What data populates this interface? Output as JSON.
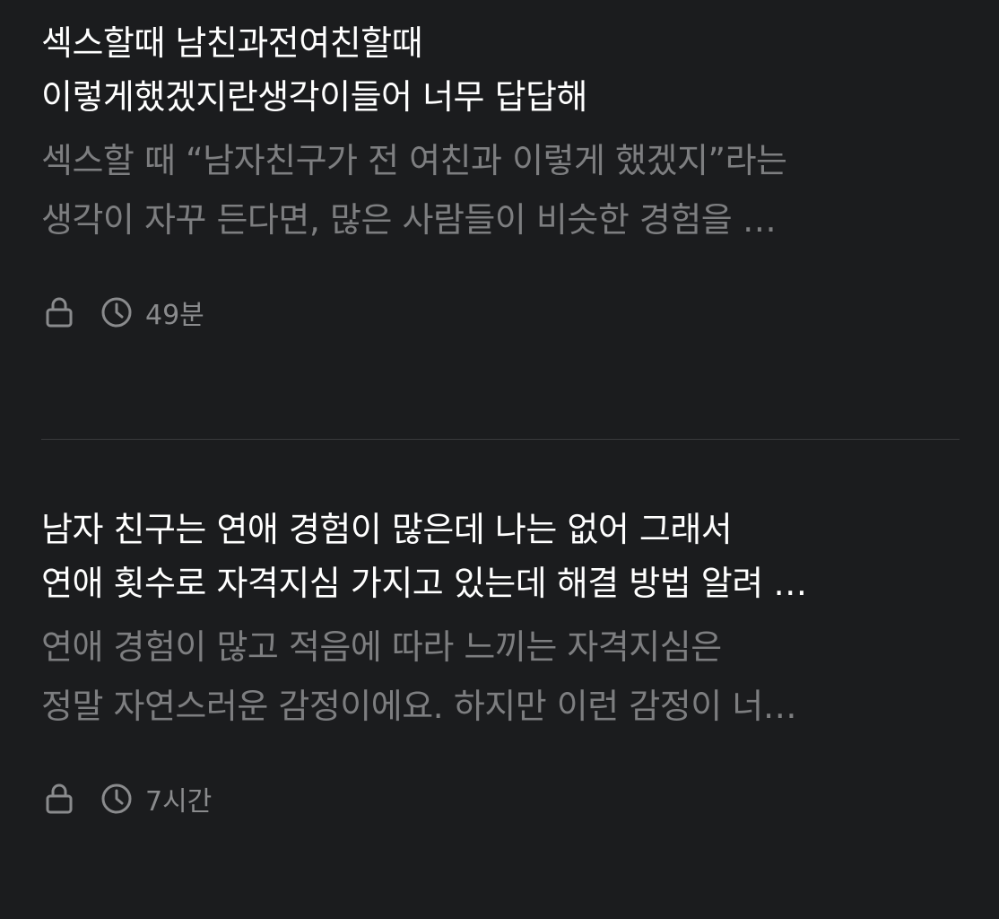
{
  "posts": [
    {
      "title_line1": "섹스할때 남친과전여친할때",
      "title_line2": "이렇게했겠지란생각이들어 너무 답답해",
      "preview_line1": "섹스할 때 “남자친구가 전 여친과 이렇게 했겠지”라는",
      "preview_line2": "생각이 자꾸 든다면, 많은 사람들이 비슷한 경험을 …",
      "time": "49분",
      "icons": [
        "lock-icon",
        "clock-icon"
      ]
    },
    {
      "title_line1": "남자 친구는 연애 경험이 많은데 나는 없어 그래서",
      "title_line2": "연애 횟수로 자격지심 가지고 있는데 해결 방법 알려 …",
      "preview_line1": "연애 경험이 많고 적음에 따라 느끼는 자격지심은",
      "preview_line2": "정말 자연스러운 감정이에요. 하지만 이런 감정이 너…",
      "time": "7시간",
      "icons": [
        "lock-icon",
        "clock-icon"
      ]
    }
  ],
  "colors": {
    "background": "#1b1c1e",
    "title": "#ffffff",
    "preview": "#7d7e80",
    "meta": "#8a8b8d",
    "divider": "#3a3b3d"
  }
}
